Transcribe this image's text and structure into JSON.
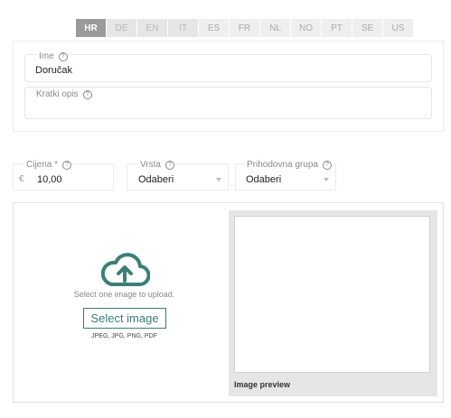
{
  "languages": [
    "HR",
    "DE",
    "EN",
    "IT",
    "ES",
    "FR",
    "NL",
    "NO",
    "PT",
    "SE",
    "US"
  ],
  "active_language": "HR",
  "name_field": {
    "label": "Ime",
    "value": "Doručak"
  },
  "description_field": {
    "label": "Kratki opis",
    "value": ""
  },
  "price_field": {
    "label": "Cijena *",
    "currency": "€",
    "value": "10,00"
  },
  "type_field": {
    "label": "Vrsta",
    "value": "Odaberi"
  },
  "revenue_group_field": {
    "label": "Prihodovna grupa",
    "value": "Odaberi"
  },
  "upload": {
    "prompt": "Select one image to upload.",
    "button_label": "Select image",
    "formats": "JPEG, JPG, PNG, PDF",
    "preview_label": "Image preview"
  },
  "colors": {
    "accent": "#3a7f78",
    "tab_active": "#9a9a9a"
  },
  "icons": {
    "help": "help-circle-icon",
    "upload": "cloud-upload-icon",
    "dropdown": "caret-down-icon"
  }
}
